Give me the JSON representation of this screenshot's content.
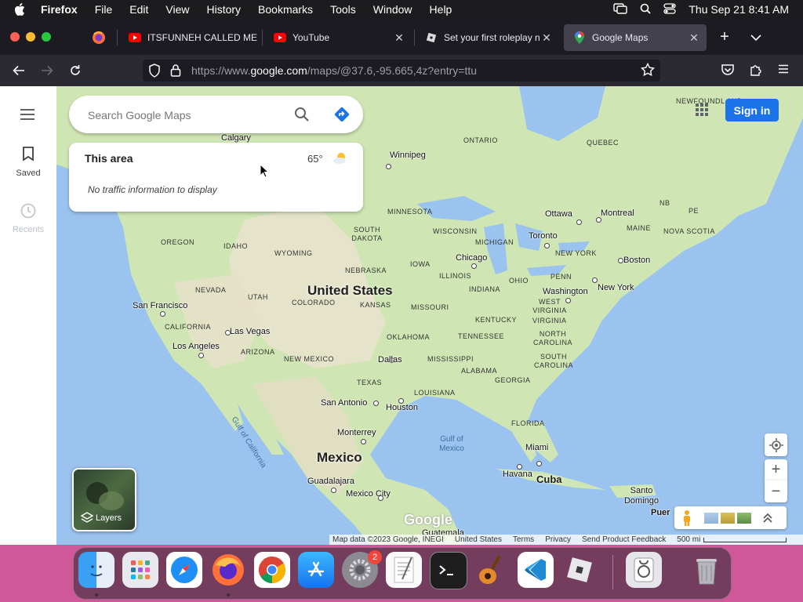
{
  "menubar": {
    "app": "Firefox",
    "items": [
      "File",
      "Edit",
      "View",
      "History",
      "Bookmarks",
      "Tools",
      "Window",
      "Help"
    ],
    "clock": "Thu Sep 21  8:41 AM"
  },
  "tabs": [
    {
      "title": "ITSFUNNEH CALLED ME",
      "icon": "youtube-icon"
    },
    {
      "title": "YouTube",
      "icon": "youtube-icon"
    },
    {
      "title": "Set your first roleplay na",
      "icon": "roblox-icon"
    },
    {
      "title": "Google Maps",
      "icon": "google-maps-icon",
      "active": true
    }
  ],
  "address": {
    "prefix": "https://www.",
    "host": "google.com",
    "path": "/maps/@37.6,-95.665,4z?entry=ttu"
  },
  "rail": {
    "saved": "Saved",
    "recents": "Recents"
  },
  "search": {
    "placeholder": "Search Google Maps"
  },
  "area_card": {
    "title": "This area",
    "temperature": "65°",
    "traffic": "No traffic information to display"
  },
  "signin": "Sign in",
  "layers": "Layers",
  "map": {
    "countries": [
      "United States",
      "Mexico",
      "Cuba"
    ],
    "cities": [
      "Calgary",
      "Winnipeg",
      "Ottawa",
      "Montreal",
      "Toronto",
      "Boston",
      "New York",
      "Chicago",
      "Washington",
      "San Francisco",
      "Las Vegas",
      "Los Angeles",
      "Dallas",
      "Houston",
      "San Antonio",
      "Monterrey",
      "Guadalajara",
      "Mexico City",
      "Miami",
      "Havana",
      "Santo Domingo",
      "Puer",
      "Guatemala"
    ],
    "regions": [
      "ONTARIO",
      "QUEBEC",
      "NEWFOUNDL AND",
      "MINNESOTA",
      "WISCONSIN",
      "MICHIGAN",
      "MAINE",
      "NB",
      "PE",
      "NOVA SCOTIA",
      "OREGON",
      "IDAHO",
      "WYOMING",
      "SOUTH DAKOTA",
      "NEBRASKA",
      "IOWA",
      "ILLINOIS",
      "OHIO",
      "PENN",
      "NEVADA",
      "UTAH",
      "COLORADO",
      "KANSAS",
      "MISSOURI",
      "INDIANA",
      "WEST VIRGINIA",
      "VIRGINIA",
      "KENTUCKY",
      "CALIFORNIA",
      "ARIZONA",
      "NEW MEXICO",
      "OKLAHOMA",
      "TENNESSEE",
      "NORTH CAROLINA",
      "SOUTH CAROLINA",
      "MISSISSIPPI",
      "ALABAMA",
      "GEORGIA",
      "TEXAS",
      "LOUISIANA",
      "FLORIDA",
      "NEW YORK"
    ],
    "water": [
      "Gulf of Mexico",
      "Gulf of California"
    ],
    "logo": "Google"
  },
  "footer": {
    "mapdata": "Map data ©2023 Google, INEGI",
    "country": "United States",
    "terms": "Terms",
    "privacy": "Privacy",
    "feedback": "Send Product Feedback",
    "scale": "500 mi"
  },
  "dock": {
    "badge": "2",
    "apps": [
      "finder-icon",
      "launchpad-icon",
      "safari-icon",
      "firefox-icon",
      "chrome-icon",
      "app-store-icon",
      "system-settings-icon",
      "textedit-icon",
      "terminal-icon",
      "garageband-icon",
      "vscode-icon",
      "roblox-icon",
      "disk-utility-icon",
      "trash-icon"
    ]
  },
  "colors": {
    "map_water": "#9bc3ef",
    "land": "#cde6b3",
    "accent": "#1a73e8"
  }
}
